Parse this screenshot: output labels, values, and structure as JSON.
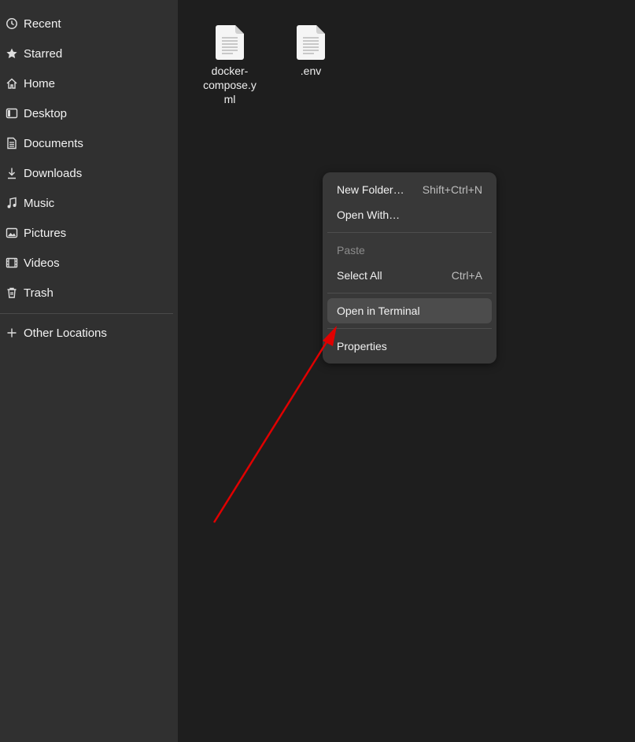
{
  "sidebar": {
    "items": [
      {
        "label": "Recent",
        "icon": "clock-icon"
      },
      {
        "label": "Starred",
        "icon": "star-icon"
      },
      {
        "label": "Home",
        "icon": "home-icon"
      },
      {
        "label": "Desktop",
        "icon": "desktop-icon"
      },
      {
        "label": "Documents",
        "icon": "document-icon"
      },
      {
        "label": "Downloads",
        "icon": "download-icon"
      },
      {
        "label": "Music",
        "icon": "music-icon"
      },
      {
        "label": "Pictures",
        "icon": "picture-icon"
      },
      {
        "label": "Videos",
        "icon": "video-icon"
      },
      {
        "label": "Trash",
        "icon": "trash-icon"
      }
    ],
    "other_locations": {
      "label": "Other Locations",
      "icon": "plus-icon"
    }
  },
  "files": [
    {
      "name_line1": "docker-",
      "name_line2": "compose.y",
      "name_line3": "ml",
      "icon": "text-file-icon"
    },
    {
      "name_line1": ".env",
      "icon": "text-file-icon"
    }
  ],
  "context_menu": {
    "new_folder": {
      "label": "New Folder…",
      "shortcut": "Shift+Ctrl+N"
    },
    "open_with": {
      "label": "Open With…"
    },
    "paste": {
      "label": "Paste"
    },
    "select_all": {
      "label": "Select All",
      "shortcut": "Ctrl+A"
    },
    "open_in_terminal": {
      "label": "Open in Terminal"
    },
    "properties": {
      "label": "Properties"
    }
  },
  "annotation": {
    "arrow_color": "#e00000"
  },
  "colors": {
    "sidebar_bg": "#303030",
    "main_bg": "#1e1e1e",
    "menu_bg": "#383838"
  }
}
